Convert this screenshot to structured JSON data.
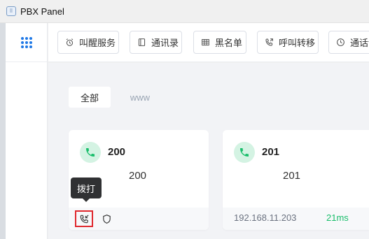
{
  "window": {
    "title": "PBX Panel",
    "app_icon_glyph": "⠿"
  },
  "toolbar": {
    "buttons": [
      {
        "label": "叫醒服务",
        "icon": "alarm-clock-icon"
      },
      {
        "label": "通讯录",
        "icon": "address-book-icon"
      },
      {
        "label": "黑名单",
        "icon": "blacklist-icon"
      },
      {
        "label": "呼叫转移",
        "icon": "call-forward-icon"
      },
      {
        "label": "通话记录",
        "icon": "clock-icon"
      }
    ]
  },
  "tabs": [
    {
      "label": "全部",
      "active": true
    },
    {
      "label": "www",
      "active": false
    }
  ],
  "cards": [
    {
      "number": "200",
      "name": "200",
      "ip": "",
      "latency": ""
    },
    {
      "number": "201",
      "name": "201",
      "ip": "192.168.11.203",
      "latency": "21ms"
    }
  ],
  "tooltip": {
    "text": "拨打"
  },
  "colors": {
    "accent": "#1e78e6",
    "online_green": "#19be6b",
    "phone_badge_bg": "#d4f3e3",
    "highlight_red": "#e0282e"
  }
}
